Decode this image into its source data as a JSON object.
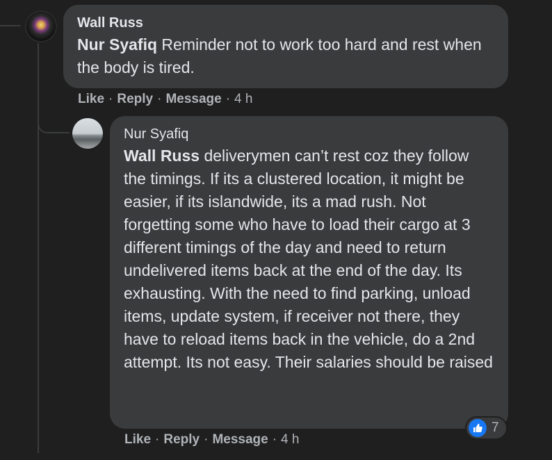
{
  "comment": {
    "author": "Wall Russ",
    "mention": "Nur Syafiq",
    "text": " Reminder not to work too hard and rest when the body is tired.",
    "actions": {
      "like": "Like",
      "reply": "Reply",
      "message": "Message",
      "time": "4 h"
    }
  },
  "reply": {
    "author": "Nur Syafiq",
    "mention": "Wall Russ",
    "text": " deliverymen can’t rest coz they follow the timings. If its a clustered location, it might be easier, if its islandwide, its a mad rush. Not forgetting some who have to load their cargo at 3 different timings of the day and need to return undelivered items back at the end of the day. Its exhausting. With the need to find parking, unload items, update system, if receiver not there, they have to reload items back in the vehicle, do a 2nd attempt. Its not easy. Their salaries should be raised",
    "actions": {
      "like": "Like",
      "reply": "Reply",
      "message": "Message",
      "time": "4 h"
    },
    "reaction": {
      "icon": "thumbs-up-icon",
      "color": "#1877f2",
      "count": "7"
    }
  },
  "colors": {
    "background": "#1f1f1f",
    "bubble": "#3a3b3c",
    "text": "#e4e6eb",
    "muted": "#b0b3b8"
  }
}
